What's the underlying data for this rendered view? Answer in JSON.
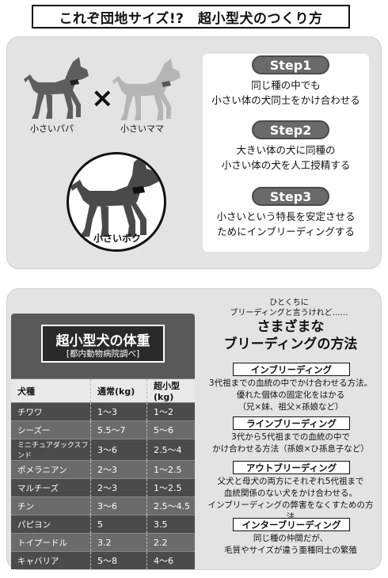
{
  "title": "これぞ団地サイズ!?　超小型犬のつくり方",
  "top": {
    "dad_label": "小さいパパ",
    "mom_label": "小さいママ",
    "puppy_label": "小さいボク",
    "steps": [
      {
        "label": "Step1",
        "lines": [
          "同じ種の中でも",
          "小さい体の犬同士をかけ合わせる"
        ]
      },
      {
        "label": "Step2",
        "lines": [
          "大きい体の犬に同種の",
          "小さい体の犬を人工授精する"
        ]
      },
      {
        "label": "Step3",
        "lines": [
          "小さいという特長を安定させる",
          "ためにインブリーディングする"
        ]
      }
    ]
  },
  "weight": {
    "title": "超小型犬の体重",
    "subtitle": "[都内動物病院調べ]",
    "headers": [
      "犬種",
      "通常(kg)",
      "超小型(kg)"
    ],
    "rows": [
      [
        "チワワ",
        "1〜3",
        "1〜2"
      ],
      [
        "シーズー",
        "5.5〜7",
        "5〜6"
      ],
      [
        "ミニチュアダックスフンド",
        "3〜6",
        "2.5〜4"
      ],
      [
        "ポメラニアン",
        "2〜3",
        "1〜2.5"
      ],
      [
        "マルチーズ",
        "2〜3",
        "1〜2.5"
      ],
      [
        "チン",
        "3〜6",
        "2.5〜4.5"
      ],
      [
        "パピヨン",
        "5",
        "3.5"
      ],
      [
        "トイプードル",
        "3.2",
        "2.2"
      ],
      [
        "キャバリア",
        "5〜8",
        "4〜6"
      ]
    ]
  },
  "breeding": {
    "intro_lines": [
      "ひとくちに",
      "ブリーディングと言うけれど……"
    ],
    "heading_lines": [
      "さまざまな",
      "ブリーディングの方法"
    ],
    "methods": [
      {
        "label": "インブリーディング",
        "lines": [
          "3代祖までの血統の中でかけ合わせる方法。",
          "優れた個体の固定化をはかる",
          "（兄×妹、祖父×孫娘など）"
        ]
      },
      {
        "label": "ラインブリーディング",
        "lines": [
          "3代から5代祖までの血統の中で",
          "かけ合わせる方法（孫娘×ひ孫息子など）"
        ]
      },
      {
        "label": "アウトブリーディング",
        "lines": [
          "父犬と母犬の両方にそれぞれ5代祖まで",
          "血統関係のない犬をかけ合わせる。",
          "インブリーディングの弊害をなくすための方法"
        ]
      },
      {
        "label": "インターブリーディング",
        "lines": [
          "同じ種の仲間だが、",
          "毛質やサイズが違う亜種同士の繁殖"
        ]
      }
    ]
  }
}
